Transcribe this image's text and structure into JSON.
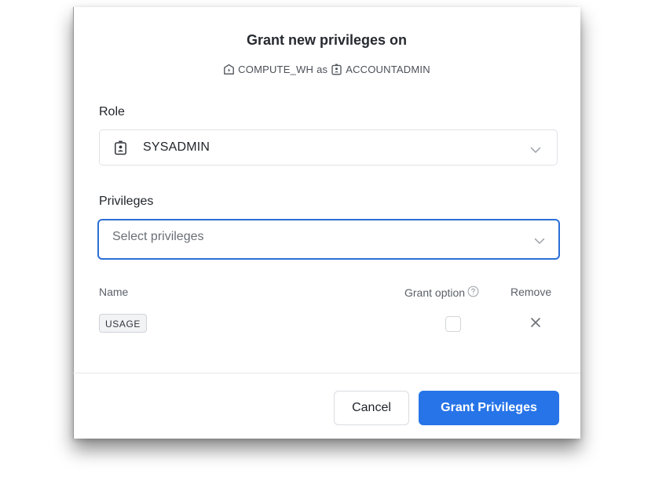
{
  "dialog": {
    "title": "Grant new privileges on",
    "subtitle": {
      "object_icon": "warehouse-icon",
      "object_name": "COMPUTE_WH",
      "joiner": "as",
      "role_icon": "role-badge-icon",
      "role_name": "ACCOUNTADMIN"
    }
  },
  "role_field": {
    "label": "Role",
    "icon": "role-badge-icon",
    "value": "SYSADMIN"
  },
  "privileges_field": {
    "label": "Privileges",
    "placeholder": "Select privileges",
    "focused": true,
    "focus_color": "#2b6fd6"
  },
  "table": {
    "headers": {
      "name": "Name",
      "grant_option": "Grant option",
      "remove": "Remove"
    },
    "rows": [
      {
        "name": "USAGE",
        "grant_option": false
      }
    ]
  },
  "footer": {
    "cancel_label": "Cancel",
    "grant_label": "Grant Privileges",
    "grant_color": "#2774e8"
  }
}
